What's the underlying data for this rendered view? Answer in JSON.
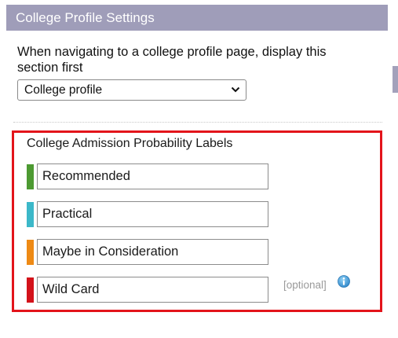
{
  "header": {
    "title": "College Profile Settings"
  },
  "navigation": {
    "description": "When navigating to a college profile page, display this section first",
    "select_value": "College profile"
  },
  "labels_section": {
    "title": "College Admission Probability Labels",
    "items": [
      {
        "value": "Recommended",
        "color": "#4d9a32"
      },
      {
        "value": "Practical",
        "color": "#3cb8c9"
      },
      {
        "value": "Maybe in Consideration",
        "color": "#ee8a15"
      },
      {
        "value": "Wild Card",
        "color": "#d3121a"
      }
    ],
    "optional_label": "[optional]",
    "info_icon": "info-icon"
  },
  "colors": {
    "header_bg": "#9f9db9",
    "highlight_border": "#e3141b",
    "info_icon": "#4aa3df"
  }
}
